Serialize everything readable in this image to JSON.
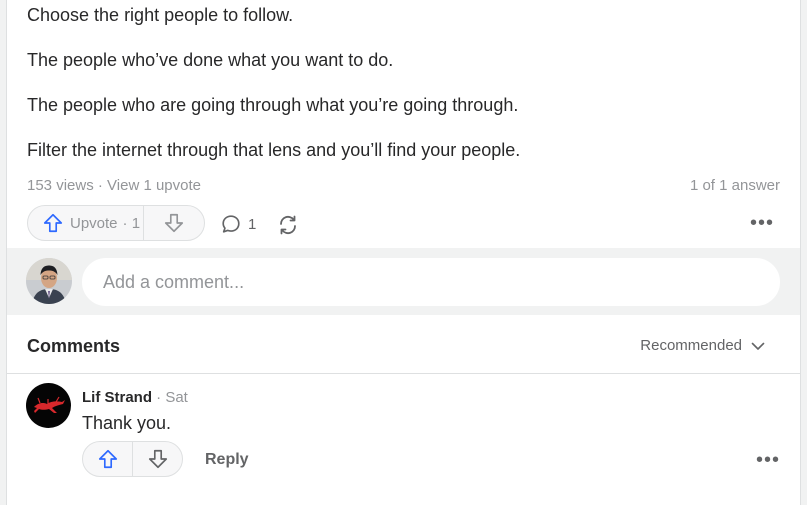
{
  "answer": {
    "paragraphs": [
      "Choose the right people to follow.",
      "The people who’ve done what you want to do.",
      "The people who are going through what you’re going through.",
      "Filter the internet through that lens and you’ll find your people."
    ],
    "views_text": "153 views",
    "separator": "·",
    "upvotes_link": "View 1 upvote",
    "answer_position": "1 of 1 answer"
  },
  "actions": {
    "upvote_label": "Upvote",
    "upvote_count": "· 1",
    "comment_count": "1"
  },
  "comment_box": {
    "placeholder": "Add a comment..."
  },
  "comments_section": {
    "title": "Comments",
    "sort_label": "Recommended"
  },
  "comments": [
    {
      "author": "Lif Strand",
      "time": "· Sat",
      "text": "Thank you.",
      "reply_label": "Reply"
    }
  ],
  "colors": {
    "upvote_blue": "#2e69ff",
    "text": "#282829",
    "muted": "#939598"
  }
}
